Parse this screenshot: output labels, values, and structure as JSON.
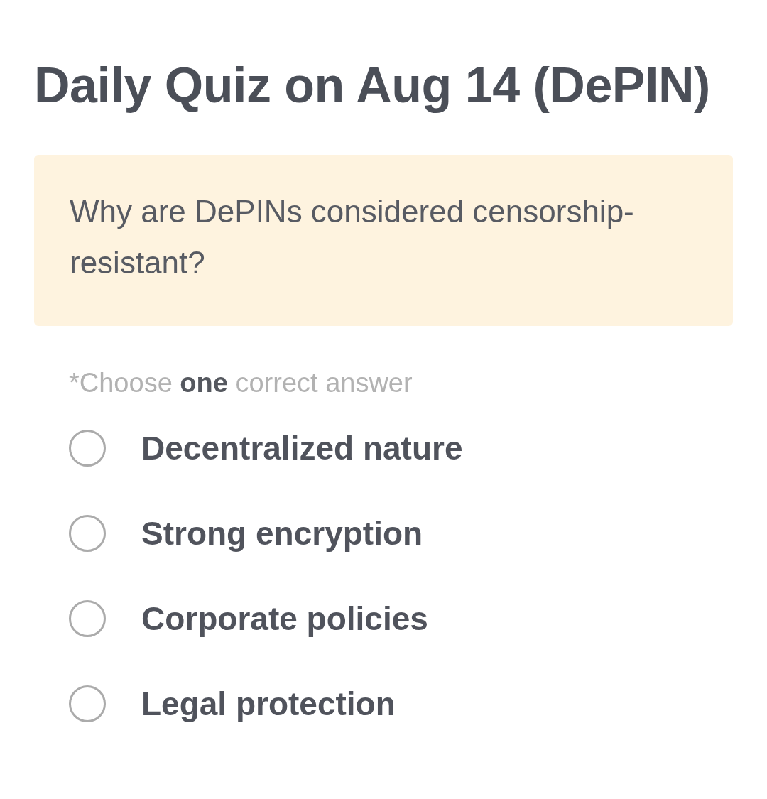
{
  "title": "Daily Quiz on Aug 14 (DePIN)",
  "question": "Why are DePINs considered censorship-resistant?",
  "hint": "*Choose **one** correct answer",
  "options": [
    {
      "label": "Decentralized nature",
      "selected": false
    },
    {
      "label": "Strong encryption",
      "selected": false
    },
    {
      "label": "Corporate policies",
      "selected": false
    },
    {
      "label": "Legal protection",
      "selected": false
    }
  ]
}
